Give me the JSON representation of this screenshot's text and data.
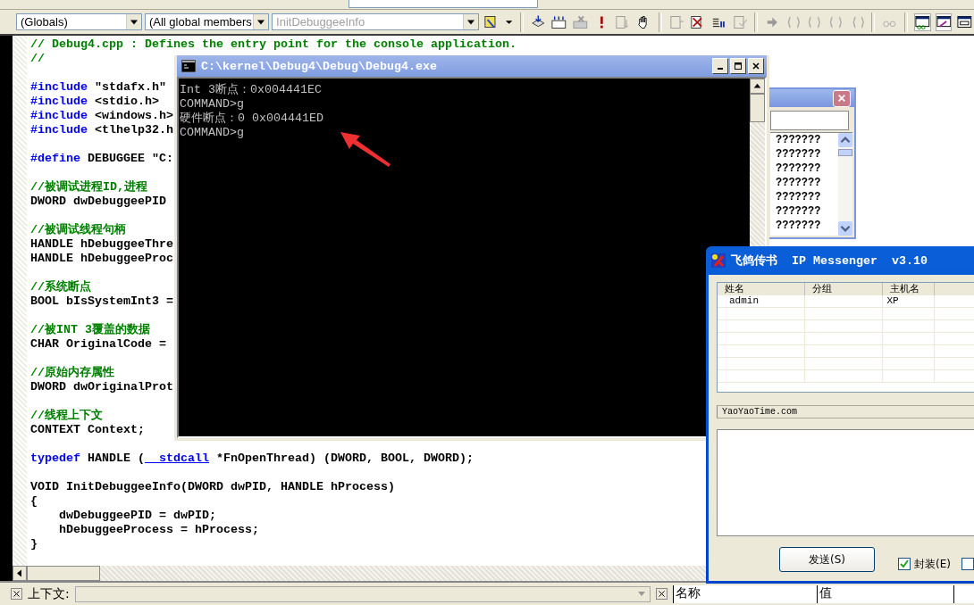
{
  "toolbar": {
    "scope_combo": "(Globals)",
    "members_combo": "(All global members",
    "function_combo": {
      "value": "InitDebuggeeInfo",
      "disabled": true
    }
  },
  "editor": {
    "lines": [
      {
        "kind": "code",
        "segments": [
          {
            "text": "// Debug4.cpp : Defines the entry point for the console application.",
            "kind": "comment"
          }
        ]
      },
      {
        "kind": "code",
        "segments": [
          {
            "text": "//",
            "kind": "comment"
          }
        ]
      },
      {
        "kind": "blank"
      },
      {
        "kind": "code",
        "segments": [
          {
            "text": "#include",
            "kind": "keyword"
          },
          {
            "text": " \"stdafx.h\"",
            "kind": "plain"
          }
        ]
      },
      {
        "kind": "code",
        "segments": [
          {
            "text": "#include",
            "kind": "keyword"
          },
          {
            "text": " <stdio.h>",
            "kind": "plain"
          }
        ]
      },
      {
        "kind": "code",
        "segments": [
          {
            "text": "#include",
            "kind": "keyword"
          },
          {
            "text": " <windows.h>",
            "kind": "plain"
          }
        ]
      },
      {
        "kind": "code",
        "segments": [
          {
            "text": "#include",
            "kind": "keyword"
          },
          {
            "text": " <tlhelp32.h",
            "kind": "plain"
          }
        ]
      },
      {
        "kind": "blank"
      },
      {
        "kind": "code",
        "segments": [
          {
            "text": "#define",
            "kind": "keyword"
          },
          {
            "text": " DEBUGGEE \"C:",
            "kind": "plain"
          }
        ]
      },
      {
        "kind": "blank"
      },
      {
        "kind": "code",
        "segments": [
          {
            "text": "//被调试进程ID,进程",
            "kind": "comment"
          }
        ]
      },
      {
        "kind": "code",
        "segments": [
          {
            "text": "DWORD dwDebuggeePID",
            "kind": "plain"
          }
        ]
      },
      {
        "kind": "blank"
      },
      {
        "kind": "code",
        "segments": [
          {
            "text": "//被调试线程句柄",
            "kind": "comment"
          }
        ]
      },
      {
        "kind": "code",
        "segments": [
          {
            "text": "HANDLE hDebuggeeThre",
            "kind": "plain"
          }
        ]
      },
      {
        "kind": "code",
        "segments": [
          {
            "text": "HANDLE hDebuggeeProc",
            "kind": "plain"
          }
        ]
      },
      {
        "kind": "blank"
      },
      {
        "kind": "code",
        "segments": [
          {
            "text": "//系统断点",
            "kind": "comment"
          }
        ]
      },
      {
        "kind": "code",
        "segments": [
          {
            "text": "BOOL bIsSystemInt3 =",
            "kind": "plain"
          }
        ]
      },
      {
        "kind": "blank"
      },
      {
        "kind": "code",
        "segments": [
          {
            "text": "//被INT 3覆盖的数据",
            "kind": "comment"
          }
        ]
      },
      {
        "kind": "code",
        "segments": [
          {
            "text": "CHAR OriginalCode =",
            "kind": "plain"
          }
        ]
      },
      {
        "kind": "blank"
      },
      {
        "kind": "code",
        "segments": [
          {
            "text": "//原始内存属性",
            "kind": "comment"
          }
        ]
      },
      {
        "kind": "code",
        "segments": [
          {
            "text": "DWORD dwOriginalProt",
            "kind": "plain"
          }
        ]
      },
      {
        "kind": "blank"
      },
      {
        "kind": "code",
        "segments": [
          {
            "text": "//线程上下文",
            "kind": "comment"
          }
        ]
      },
      {
        "kind": "code",
        "segments": [
          {
            "text": "CONTEXT Context;",
            "kind": "plain"
          }
        ]
      },
      {
        "kind": "blank"
      },
      {
        "kind": "code",
        "segments": [
          {
            "text": "typedef",
            "kind": "keyword"
          },
          {
            "text": " HANDLE (",
            "kind": "plain"
          },
          {
            "text": "__stdcall",
            "kind": "link"
          },
          {
            "text": " *FnOpenThread) (DWORD, BOOL, DWORD);",
            "kind": "plain"
          }
        ]
      },
      {
        "kind": "blank"
      },
      {
        "kind": "code",
        "segments": [
          {
            "text": "VOID InitDebuggeeInfo(DWORD dwPID, HANDLE hProcess)",
            "kind": "plain"
          }
        ]
      },
      {
        "kind": "code",
        "segments": [
          {
            "text": "{",
            "kind": "plain"
          }
        ]
      },
      {
        "kind": "code",
        "segments": [
          {
            "text": "    dwDebuggeePID = dwPID;",
            "kind": "plain"
          }
        ]
      },
      {
        "kind": "code",
        "segments": [
          {
            "text": "    hDebuggeeProcess = hProcess;",
            "kind": "plain"
          }
        ]
      },
      {
        "kind": "code",
        "segments": [
          {
            "text": "}",
            "kind": "plain"
          }
        ]
      }
    ]
  },
  "console": {
    "title": "C:\\kernel\\Debug4\\Debug\\Debug4.exe",
    "lines": [
      "Int 3断点：0x004441EC",
      "COMMAND>g",
      "硬件断点：0 0x004441ED",
      "COMMAND>g"
    ]
  },
  "back_window": {
    "items": [
      "???????",
      "???????",
      "???????",
      "???????",
      "???????",
      "???????",
      "???????"
    ]
  },
  "messenger": {
    "title": "飞鸽传书  IP Messenger  v3.10",
    "columns": [
      "姓名",
      "分组",
      "主机名"
    ],
    "rows": [
      {
        "name": "admin",
        "host": "XP"
      }
    ],
    "status": "YaoYaoTime.com",
    "send_button": "发送(S)",
    "options": [
      {
        "label": "封装(E)",
        "checked": true
      },
      {
        "checked": false
      }
    ]
  },
  "bottom_panel": {
    "context_label": "上下文:",
    "columns": [
      "名称",
      "值"
    ]
  }
}
